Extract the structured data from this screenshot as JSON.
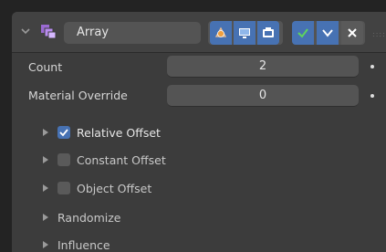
{
  "modifier": {
    "name": "Array",
    "expanded": true,
    "toggles": {
      "edit_mode_cage": false,
      "edit_mode": true,
      "realtime": true,
      "render": true,
      "apply": "✓",
      "dropdown": "chevron-down",
      "delete": "✕"
    }
  },
  "properties": [
    {
      "label": "Count",
      "value": "2"
    },
    {
      "label": "Material Override",
      "value": "0"
    }
  ],
  "subpanels": [
    {
      "label": "Relative Offset",
      "has_checkbox": true,
      "checked": true
    },
    {
      "label": "Constant Offset",
      "has_checkbox": true,
      "checked": false
    },
    {
      "label": "Object Offset",
      "has_checkbox": true,
      "checked": false
    },
    {
      "label": "Randomize",
      "has_checkbox": false
    },
    {
      "label": "Influence",
      "has_checkbox": false
    }
  ],
  "colors": {
    "accent": "#4772b3",
    "panel": "#3c3c3c",
    "field": "#545454",
    "background": "#232323"
  }
}
